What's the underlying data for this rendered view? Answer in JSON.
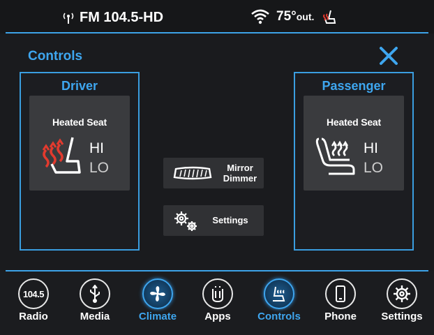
{
  "status": {
    "radio_station": "FM 104.5-HD",
    "temperature": "75°",
    "temperature_suffix": "out."
  },
  "header": {
    "title": "Controls"
  },
  "driver": {
    "label": "Driver",
    "heated_seat_label": "Heated Seat",
    "hi": "HI",
    "lo": "LO",
    "active_level_color": "#e23a2e"
  },
  "passenger": {
    "label": "Passenger",
    "heated_seat_label": "Heated Seat",
    "hi": "HI",
    "lo": "LO"
  },
  "middle": {
    "mirror_dimmer_line1": "Mirror",
    "mirror_dimmer_line2": "Dimmer",
    "settings_label": "Settings"
  },
  "nav": {
    "items": [
      {
        "label": "Radio",
        "icon_text": "104.5",
        "active": false
      },
      {
        "label": "Media",
        "icon": "usb-icon",
        "active": false
      },
      {
        "label": "Climate",
        "icon": "fan-icon",
        "active": true
      },
      {
        "label": "Apps",
        "icon": "apps-icon",
        "active": false
      },
      {
        "label": "Controls",
        "icon": "seat-controls-icon",
        "active": true
      },
      {
        "label": "Phone",
        "icon": "phone-icon",
        "active": false
      },
      {
        "label": "Settings",
        "icon": "gear-icon",
        "active": false
      }
    ]
  },
  "colors": {
    "accent": "#3ea6ef",
    "heat_red": "#e23a2e"
  }
}
